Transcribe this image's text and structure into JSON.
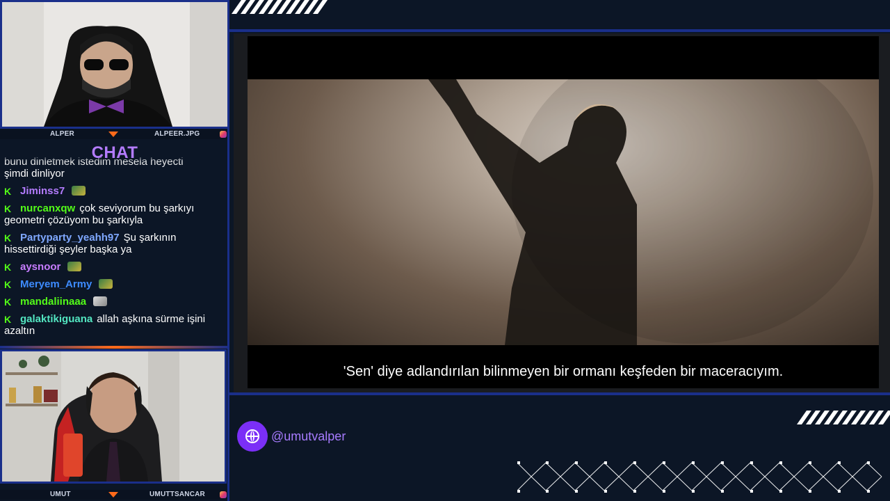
{
  "top_cam": {
    "left_name": "ALPER",
    "right_name": "ALPEER.JPG"
  },
  "chat": {
    "title": "CHAT",
    "partial_message": "bunu dinletmek istedim mesela heyecti",
    "messages": [
      {
        "user": "",
        "text": "şimdi dinliyor",
        "color": "#ffffff",
        "emote": false,
        "badge": false
      },
      {
        "user": "Jiminss7",
        "text": "",
        "color": "#b47cff",
        "emote": true,
        "badge": true
      },
      {
        "user": "nurcanxqw",
        "text": "çok seviyorum bu şarkıyı geometri çözüyom bu şarkıyla",
        "color": "#53fc18",
        "emote": false,
        "badge": true
      },
      {
        "user": "Partyparty_yeahh97",
        "text": "Şu şarkının hissettirdiği şeyler başka ya",
        "color": "#7fa8ff",
        "emote": false,
        "badge": true
      },
      {
        "user": "aysnoor",
        "text": "",
        "color": "#c77dff",
        "emote": true,
        "badge": true
      },
      {
        "user": "Meryem_Army",
        "text": "",
        "color": "#3d8bff",
        "emote": true,
        "badge": true
      },
      {
        "user": "mandaliinaaa",
        "text": "",
        "color": "#53fc18",
        "emote": true,
        "badge": true
      },
      {
        "user": "galaktikiguana",
        "text": "allah aşkına sürme işini azaltın",
        "color": "#53e6c1",
        "emote": false,
        "badge": true
      }
    ]
  },
  "bottom_cam": {
    "left_name": "UMUT",
    "right_name": "UMUTTSANCAR"
  },
  "video": {
    "subtitle": "'Sen' diye adlandırılan bilinmeyen bir ormanı keşfeden bir maceracıyım."
  },
  "footer": {
    "handle": "@umutvalper"
  },
  "colors": {
    "accent": "#7b2ff7",
    "frame": "#1a2f8a",
    "kick_green": "#53fc18",
    "orange": "#ff6a1a"
  },
  "icons": {
    "globe": "globe-icon",
    "instagram": "instagram-icon",
    "kick": "kick-badge-icon"
  }
}
